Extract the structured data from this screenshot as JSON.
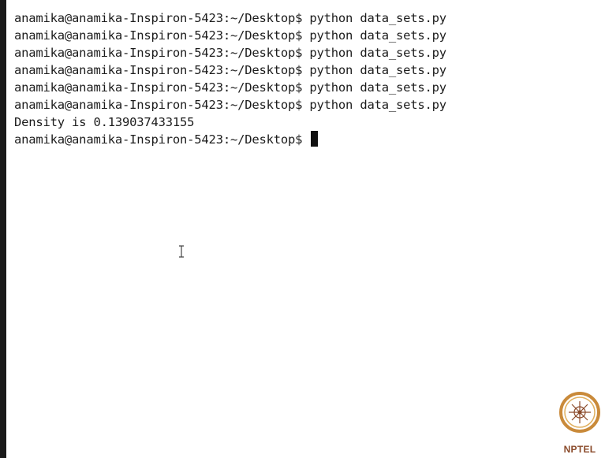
{
  "terminal": {
    "lines": [
      "anamika@anamika-Inspiron-5423:~/Desktop$ python data_sets.py",
      "anamika@anamika-Inspiron-5423:~/Desktop$ python data_sets.py",
      "anamika@anamika-Inspiron-5423:~/Desktop$ python data_sets.py",
      "anamika@anamika-Inspiron-5423:~/Desktop$ python data_sets.py",
      "anamika@anamika-Inspiron-5423:~/Desktop$ python data_sets.py",
      "anamika@anamika-Inspiron-5423:~/Desktop$ python data_sets.py",
      "Density is 0.139037433155"
    ],
    "prompt": "anamika@anamika-Inspiron-5423:~/Desktop$ "
  },
  "logo": {
    "text": "NPTEL",
    "color": "#8a4a2a"
  },
  "colors": {
    "background": "#ffffff",
    "text": "#1c1c1c",
    "cursor": "#111111"
  }
}
